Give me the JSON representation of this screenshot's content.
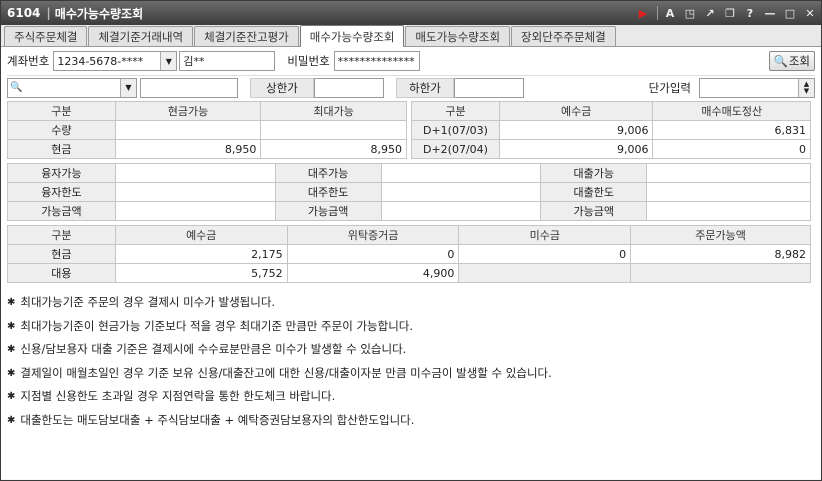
{
  "title": {
    "code": "6104",
    "name": "매수가능수량조회"
  },
  "tabs": [
    {
      "label": "주식주문체결"
    },
    {
      "label": "체결기준거래내역"
    },
    {
      "label": "체결기준잔고평가"
    },
    {
      "label": "매수가능수량조회",
      "active": true
    },
    {
      "label": "매도가능수량조회"
    },
    {
      "label": "장외단주주문체결"
    }
  ],
  "account": {
    "label": "계좌번호",
    "number": "1234-5678-****",
    "holder": "김**",
    "pw_label": "비밀번호",
    "pw_value": "**************",
    "query_label": "조회"
  },
  "search": {
    "upper_label": "상한가",
    "lower_label": "하한가",
    "unit_label": "단가입력"
  },
  "table1": {
    "headers": [
      "구분",
      "현금가능",
      "최대가능"
    ],
    "rows": [
      {
        "label": "수량",
        "cash": "",
        "max": ""
      },
      {
        "label": "현금",
        "cash": "8,950",
        "max": "8,950"
      }
    ]
  },
  "table2": {
    "headers": [
      "구분",
      "예수금",
      "매수매도정산"
    ],
    "rows": [
      {
        "label": "D+1(07/03)",
        "deposit": "9,006",
        "settle": "6,831"
      },
      {
        "label": "D+2(07/04)",
        "deposit": "9,006",
        "settle": "0"
      }
    ]
  },
  "credit": {
    "col1": [
      "융자가능",
      "융자한도",
      "가능금액"
    ],
    "col2": [
      "대주가능",
      "대주한도",
      "가능금액"
    ],
    "col3": [
      "대출가능",
      "대출한도",
      "가능금액"
    ]
  },
  "table3": {
    "headers": [
      "구분",
      "예수금",
      "위탁증거금",
      "미수금",
      "주문가능액"
    ],
    "rows": [
      {
        "label": "현금",
        "deposit": "2,175",
        "margin": "0",
        "unpaid": "0",
        "orderable": "8,982"
      },
      {
        "label": "대용",
        "deposit": "5,752",
        "margin": "4,900",
        "unpaid": "",
        "orderable": ""
      }
    ]
  },
  "notes": [
    "최대가능기준 주문의 경우 결제시 미수가 발생됩니다.",
    "최대가능기준이 현금가능 기준보다 적을 경우 최대기준 만큼만 주문이 가능합니다.",
    "신용/담보용자 대출 기준은 결제시에 수수료분만큼은 미수가 발생할 수 있습니다.",
    "결제일이 매월초일인 경우 기준 보유 신용/대출잔고에 대한 신용/대출이자분 만큼 미수금이 발생할 수 있습니다.",
    "지점별 신용한도 초과일 경우 지점연락을 통한 한도체크 바랍니다.",
    "대출한도는 매도담보대출 + 주식담보대출 + 예탁증권담보용자의 합산한도입니다."
  ],
  "icons": {
    "title_buttons": [
      "play-icon",
      "font-icon",
      "popup-icon",
      "link-icon",
      "window-icon",
      "help-icon",
      "minimize-icon",
      "maximize-icon",
      "close-icon"
    ]
  }
}
